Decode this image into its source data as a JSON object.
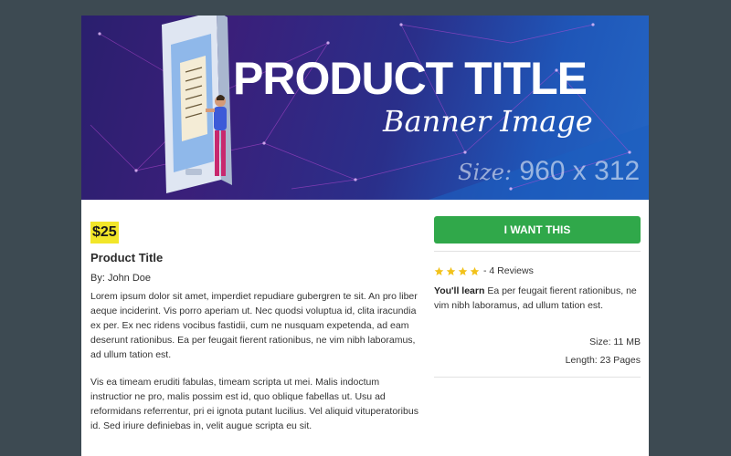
{
  "colors": {
    "page_background": "#3d4a52",
    "price_highlight": "#f2e629",
    "buy_button": "#30a84a",
    "star": "#f2c21b"
  },
  "banner": {
    "title": "PRODUCT TITLE",
    "subtitle": "Banner Image",
    "size_label": "Size:",
    "size_value": "960 x 312"
  },
  "product": {
    "price": "$25",
    "title": "Product Title",
    "author": "By: John Doe",
    "description": [
      "Lorem ipsum dolor sit amet, imperdiet repudiare gubergren te sit. An pro liber aeque inciderint. Vis porro aperiam ut. Nec quodsi voluptua id, clita iracundia ex per. Ex nec ridens vocibus fastidii, cum ne nusquam expetenda, ad eam deserunt rationibus. Ea per feugait fierent rationibus, ne vim nibh laboramus, ad ullum tation est.",
      "Vis ea timeam eruditi fabulas, timeam scripta ut mei. Malis indoctum instructior ne pro, malis possim est id, quo oblique fabellas ut. Usu ad reformidans referrentur, pri ei ignota putant lucilius. Vel aliquid vituperatoribus id. Sed iriure definiebas in, velit augue scripta eu sit."
    ]
  },
  "sidebar": {
    "buy_label": "I WANT THIS",
    "rating_stars": 4,
    "reviews_text": "- 4 Reviews",
    "learn_label": "You'll learn",
    "learn_text": "Ea per feugait fierent rationibus, ne vim nibh laboramus, ad ullum tation est.",
    "size": "Size: 11 MB",
    "length": "Length: 23 Pages"
  }
}
